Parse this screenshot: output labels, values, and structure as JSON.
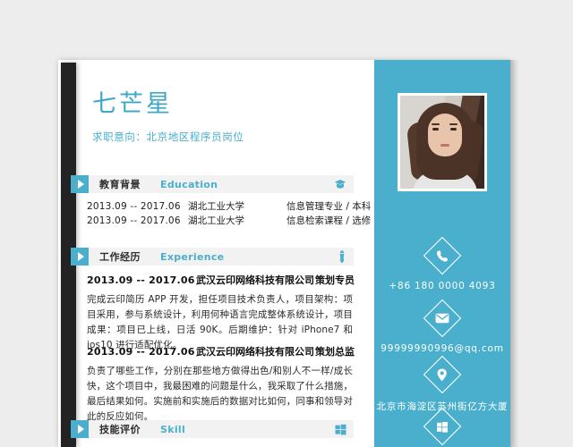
{
  "header": {
    "name": "七芒星",
    "objective": "求职意向：北京地区程序员岗位"
  },
  "sections": {
    "education": {
      "cn": "教育背景",
      "en": "Education",
      "icon": "graduation-cap-icon"
    },
    "experience": {
      "cn": "工作经历",
      "en": "Experience",
      "icon": "necktie-icon"
    },
    "skill": {
      "cn": "技能评价",
      "en": "Skill",
      "icon": "windows-logo-icon"
    }
  },
  "education_rows": [
    {
      "date": "2013.09 -- 2017.06",
      "school": "湖北工业大学",
      "meta": "信息管理专业 / 本科"
    },
    {
      "date": "2013.09 -- 2017.06",
      "school": "湖北工业大学",
      "meta": "信息检索课程 / 选修"
    }
  ],
  "experience_items": [
    {
      "date": "2013.09 -- 2017.06",
      "company": "武汉云印网络科技有限公司",
      "title": "策划专员",
      "description": "完成云印简历 APP 开发，担任项目技术负责人，项目架构：项目采用，参与系统设计，利用何种语言完成整体系统设计，项目成果：项目已上线，日活 90K。后期维护：针对 iPhone7 和 ios10 进行适配优化。"
    },
    {
      "date": "2013.09 -- 2017.06",
      "company": "武汉云印网络科技有限公司",
      "title": "策划总监",
      "description": "负责了哪些工作，分别在那些地方做得出色/和别人不一样/成长快，这个项目中，我最困难的问题是什么，我采取了什么措施，最后结果如何。实施前和实施后的数据对比如何，同事和领导对此的反应如何。"
    }
  ],
  "contacts": [
    {
      "icon": "phone-icon",
      "value": "+86    180    0000    4093"
    },
    {
      "icon": "envelope-icon",
      "value": "99999990996@qq.com"
    },
    {
      "icon": "location-pin-icon",
      "value": "北京市海淀区苏州街亿方大厦"
    },
    {
      "icon": "windows-logo-icon",
      "value": ""
    }
  ],
  "colors": {
    "accent": "#4aafcc",
    "spine": "#232323",
    "page": "#ffffff",
    "background": "#ededed",
    "bar": "#f2f2f2"
  }
}
